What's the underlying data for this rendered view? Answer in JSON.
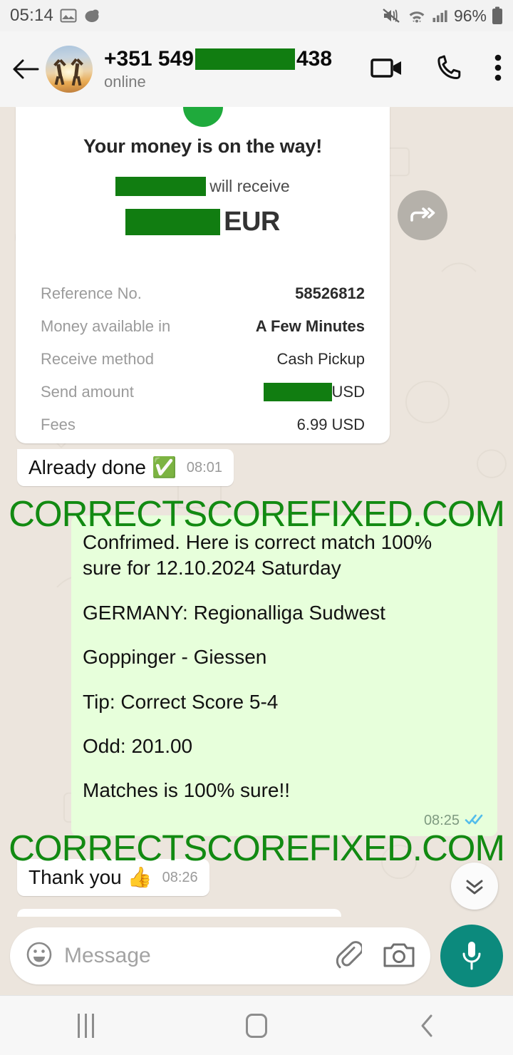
{
  "status_bar": {
    "clock": "05:14",
    "battery_percent": "96%",
    "icons": [
      "image-icon",
      "app-icon",
      "mute-icon",
      "wifi-icon",
      "signal-icon",
      "battery-icon"
    ]
  },
  "header": {
    "back_icon": "back-arrow-icon",
    "avatar_icon": "contact-avatar",
    "contact_name_prefix": "+351 549",
    "contact_name_suffix": "438",
    "presence": "online",
    "video_call_icon": "video-call-icon",
    "voice_call_icon": "phone-call-icon",
    "overflow_icon": "more-options-icon"
  },
  "receipt": {
    "title": "Your money is on the way!",
    "receive_label": "will receive",
    "currency": "EUR",
    "rows": [
      {
        "key": "Reference No.",
        "value": "58526812",
        "bold": true,
        "redacted": false
      },
      {
        "key": "Money available in",
        "value": "A Few Minutes",
        "bold": true,
        "redacted": false
      },
      {
        "key": "Receive method",
        "value": "Cash Pickup",
        "bold": false,
        "redacted": false
      },
      {
        "key": "Send amount",
        "value": "USD",
        "bold": false,
        "redacted": true
      },
      {
        "key": "Fees",
        "value": "6.99 USD",
        "bold": false,
        "redacted": false
      }
    ],
    "forward_icon": "forward-icon"
  },
  "messages": {
    "already_done": {
      "text": "Already done",
      "emoji": "✅",
      "time": "08:01"
    },
    "tip": {
      "lines": [
        "Confrimed. Here is correct match 100%",
        "sure for 12.10.2024 Saturday",
        "",
        "GERMANY: Regionalliga Sudwest",
        "",
        "Goppinger - Giessen",
        "",
        "Tip: Correct Score 5-4",
        "",
        "Odd: 201.00",
        "",
        "Matches is 100% sure!!"
      ],
      "time": "08:25",
      "receipt_status": "read-receipt-icon"
    },
    "thank_you": {
      "text": "Thank you",
      "emoji": "👍",
      "time": "08:26"
    }
  },
  "scroll_button_icon": "scroll-to-bottom-icon",
  "watermark": {
    "text": "CORRECTSCOREFIXED.COM",
    "color": "#128a12"
  },
  "input_bar": {
    "emoji_icon": "emoji-icon",
    "placeholder": "Message",
    "attach_icon": "attachment-icon",
    "camera_icon": "camera-icon",
    "mic_icon": "microphone-icon",
    "mic_color": "#0c8a7d"
  },
  "nav_bar": {
    "recents_icon": "recents-icon",
    "home_icon": "home-icon",
    "back_icon": "nav-back-icon"
  },
  "colors": {
    "redaction_green": "#117d11",
    "outgoing_bubble": "#e7ffdb",
    "chat_background": "#ece5dd"
  }
}
